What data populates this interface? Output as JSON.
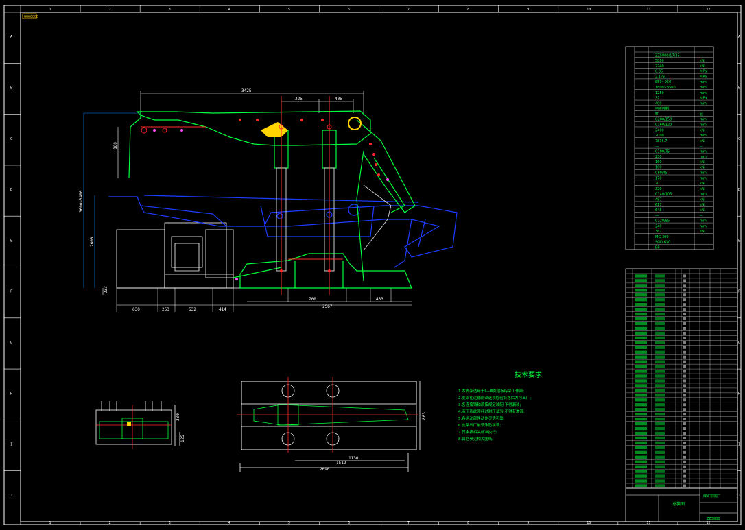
{
  "drawing": {
    "stamp": "0000000",
    "zone_numbers_top": [
      "1",
      "2",
      "3",
      "4",
      "5",
      "6",
      "7",
      "8",
      "9",
      "10",
      "11",
      "12"
    ],
    "zone_letters_side": [
      "A",
      "B",
      "C",
      "D",
      "E",
      "F",
      "G",
      "H",
      "I",
      "J"
    ]
  },
  "main_view": {
    "dims_top": [
      "3425",
      "225",
      "405"
    ],
    "dims_left": [
      "800",
      "3600~3400",
      "2600",
      "233"
    ],
    "dims_bottom": [
      "630",
      "253",
      "532",
      "414",
      "700",
      "2567",
      "433"
    ]
  },
  "plan_view": {
    "dims": [
      "1130",
      "1512",
      "2690",
      "803"
    ]
  },
  "end_view": {
    "dims": [
      "330",
      "125"
    ]
  },
  "tech_notes": {
    "title": "技术要求",
    "lines": [
      "1.本支架适用于Ⅱ—Ⅲ类顶板综采工作面;",
      "2.支架在运输前须逐项检验合格后方可出厂;",
      "3.各连接销轴须按规定装配,不得漏装;",
      "4.液压系统须经过耐压试验,不得有渗漏;",
      "5.各运动部件动作灵活可靠;",
      "6.支架出厂前须涂防锈漆;",
      "7.其余按相关标准执行;",
      "8.其它参见相关图纸。"
    ]
  },
  "param_table": {
    "rows": [
      [
        "ZZ5800/17/35",
        "—"
      ],
      [
        "5800",
        "kN"
      ],
      [
        "2240",
        "kN"
      ],
      [
        "0.85",
        "MPa"
      ],
      [
        "2.175",
        "MPa"
      ],
      [
        "850~950",
        "mm"
      ],
      [
        "1800~3500",
        "mm"
      ],
      [
        "1250",
        "mm"
      ],
      [
        "32",
        "MPa"
      ],
      [
        "400",
        "mm"
      ],
      [
        "电液控制",
        ""
      ],
      [
        "缸",
        "径"
      ],
      [
        "C200/150",
        "mm"
      ],
      [
        "C160/120",
        "mm"
      ],
      [
        "2400",
        "kN"
      ],
      [
        "2000",
        "mm"
      ],
      [
        "7836.7",
        "kN"
      ],
      [
        "—",
        "—"
      ],
      [
        "C100/75",
        "mm"
      ],
      [
        "230",
        "mm"
      ],
      [
        "160",
        "kN"
      ],
      [
        "100",
        "kN"
      ],
      [
        "C80/45",
        "mm"
      ],
      [
        "170",
        "mm"
      ],
      [
        "70",
        "kN"
      ],
      [
        "320",
        "kN"
      ],
      [
        "C140/105",
        "mm"
      ],
      [
        "487",
        "kN"
      ],
      [
        "617",
        "kN"
      ],
      [
        "648",
        "kN"
      ],
      [
        "—",
        "—"
      ],
      [
        "C120/85",
        "mm"
      ],
      [
        "240",
        "mm"
      ],
      [
        "362",
        "kN"
      ],
      [
        "MG-300",
        ""
      ],
      [
        "SGD-630",
        ""
      ],
      [
        "BP",
        ""
      ]
    ]
  },
  "parts_list": {
    "row_count": 46
  },
  "title_block": {
    "assembly_label": "总装图",
    "company": "煤矿机械厂",
    "drawing_no": "ZZ5800"
  }
}
